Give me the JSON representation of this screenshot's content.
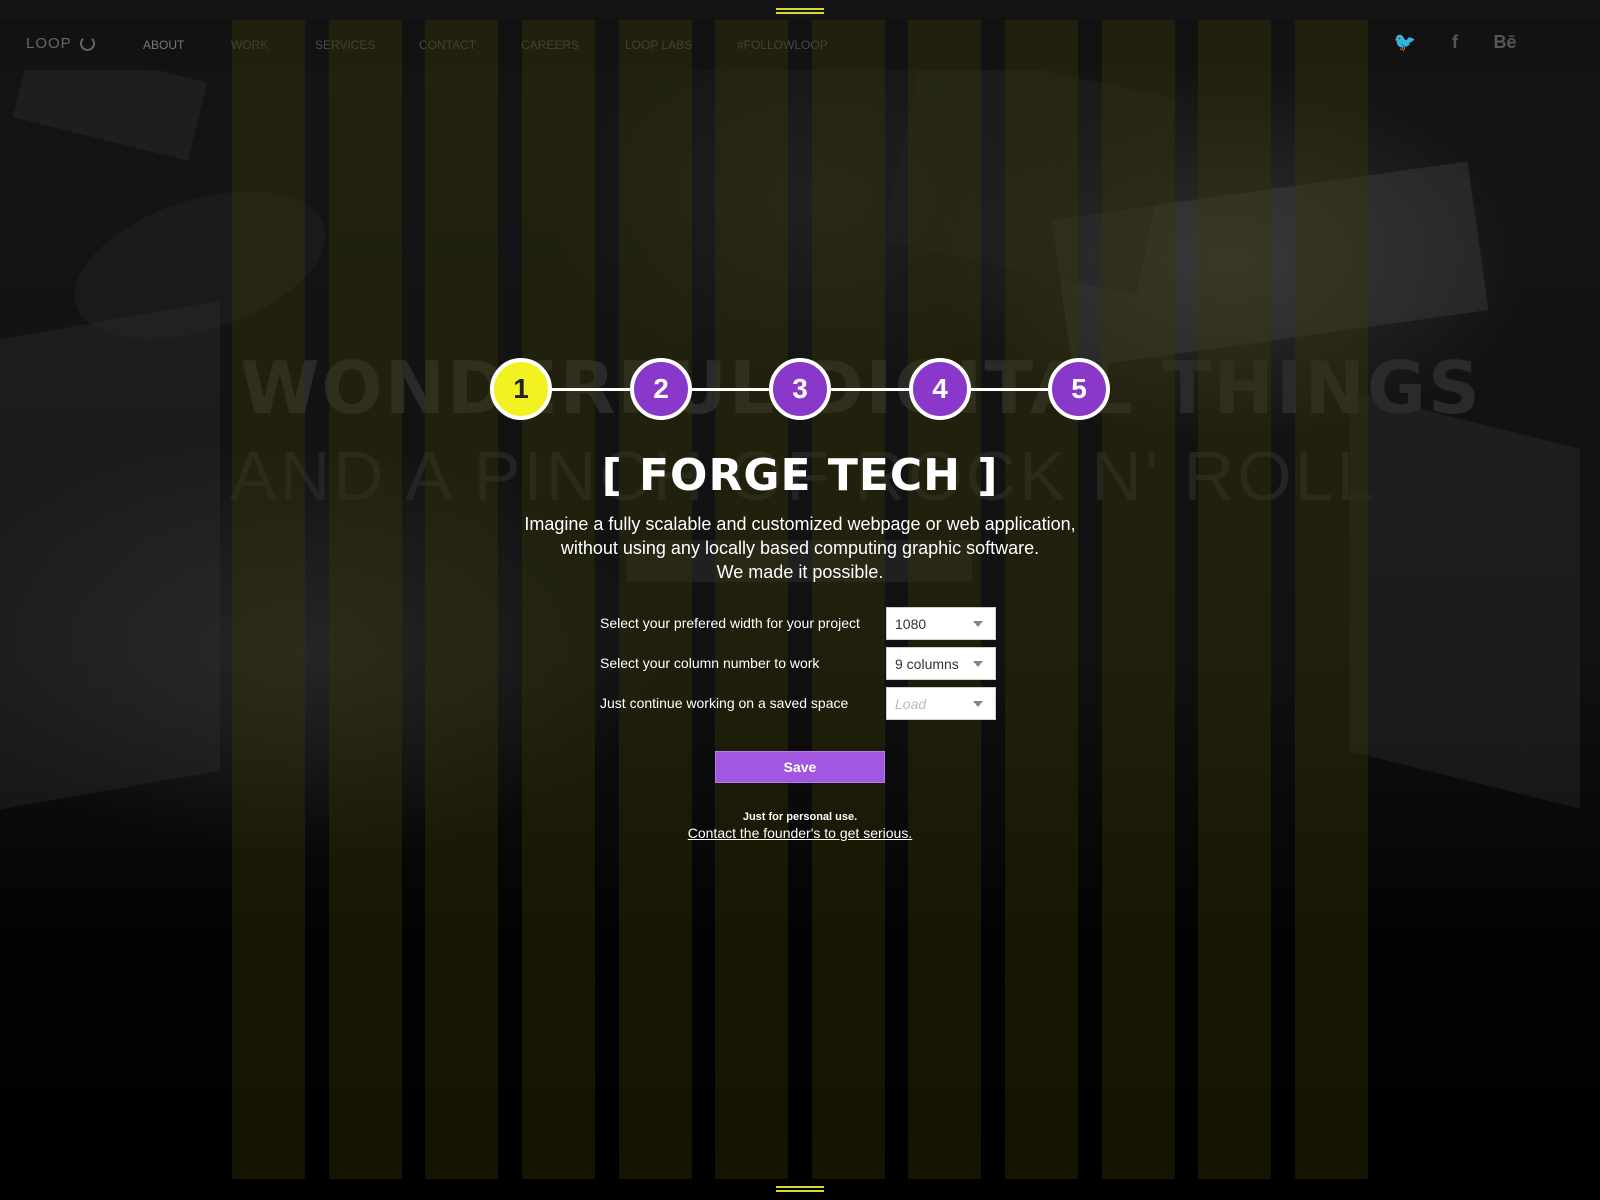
{
  "site": {
    "logo": "LOOP",
    "nav": [
      "ABOUT",
      "WORK",
      "SERVICES",
      "CONTACT",
      "CAREERS",
      "LOOP LABS",
      "#FOLLOWLOOP"
    ],
    "social": [
      {
        "name": "twitter-icon",
        "glyph": "🐦"
      },
      {
        "name": "facebook-icon",
        "glyph": "f"
      },
      {
        "name": "behance-icon",
        "glyph": "Bē"
      }
    ],
    "hero_line1": "WONDERFUL DIGITAL THINGS",
    "hero_line2": "AND A PINCH OF ROCK N' ROLL"
  },
  "grid": {
    "columns": 12,
    "color": "#37370a"
  },
  "wizard": {
    "steps": [
      "1",
      "2",
      "3",
      "4",
      "5"
    ],
    "current_step": 1,
    "title": "[ FORGE TECH ]",
    "description": [
      "Imagine a fully scalable and customized webpage or web application,",
      "without using any locally based computing graphic software.",
      "We made it possible."
    ],
    "fields": [
      {
        "label": "Select your prefered width for your project",
        "value": "1080"
      },
      {
        "label": "Select your column number to work",
        "value": "9 columns"
      },
      {
        "label": "Just continue working on a saved space",
        "placeholder": "Load"
      }
    ],
    "save_label": "Save",
    "note": "Just for personal use.",
    "contact_link": "Contact the founder's to get serious."
  },
  "colors": {
    "accent": "#a257e0",
    "step": "#8a38c9",
    "current_step": "#f2f222",
    "grid_handle": "#d7d73a"
  }
}
